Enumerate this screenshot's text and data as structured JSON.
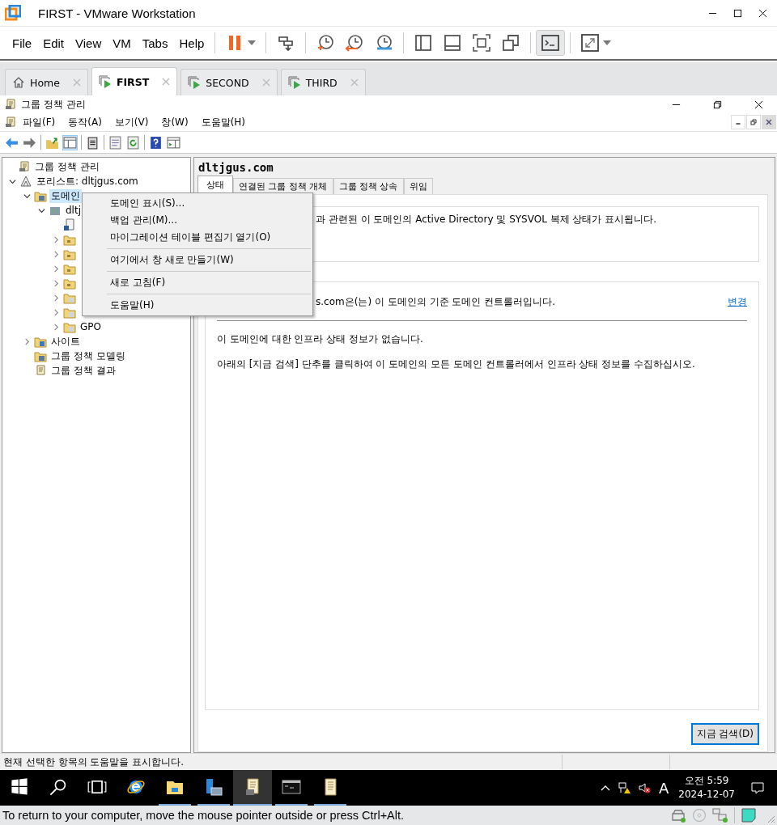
{
  "window": {
    "title": "FIRST - VMware Workstation"
  },
  "menu": [
    "File",
    "Edit",
    "View",
    "VM",
    "Tabs",
    "Help"
  ],
  "toolbar": [
    {
      "kind": "pause",
      "selected": false
    },
    {
      "kind": "send-keys",
      "selected": false
    },
    {
      "kind": "snapshot-take",
      "selected": false
    },
    {
      "kind": "snapshot-revert",
      "selected": false
    },
    {
      "kind": "snapshot-manage",
      "selected": false
    },
    {
      "kind": "library",
      "selected": false
    },
    {
      "kind": "thumbnails",
      "selected": false
    },
    {
      "kind": "fullscreen",
      "selected": false
    },
    {
      "kind": "unity",
      "selected": false
    },
    {
      "kind": "console",
      "selected": true
    },
    {
      "kind": "stretch",
      "selected": false
    }
  ],
  "vm_tabs": [
    {
      "label": "Home",
      "kind": "home",
      "selected": false
    },
    {
      "label": "FIRST",
      "kind": "vm",
      "selected": true
    },
    {
      "label": "SECOND",
      "kind": "vm",
      "selected": false
    },
    {
      "label": "THIRD",
      "kind": "vm",
      "selected": false
    }
  ],
  "guest": {
    "title": "그룹 정책 관리",
    "menu": [
      "파일(F)",
      "동작(A)",
      "보기(V)",
      "창(W)",
      "도움말(H)"
    ],
    "tree": [
      {
        "label": "그룹 정책 관리",
        "kind": "gpm",
        "selected": false,
        "children": [
          {
            "label": "포리스트: dltjgus.com",
            "kind": "forest",
            "expanded": true,
            "selected": false,
            "children": [
              {
                "label": "도메인",
                "kind": "domains",
                "expanded": true,
                "selected": true,
                "children": [
                  {
                    "label": "dltj",
                    "kind": "domain",
                    "expanded": true,
                    "selected": false,
                    "children": [
                      {
                        "kind": "gpo-link",
                        "selected": false
                      },
                      {
                        "kind": "ou",
                        "expanded": false,
                        "selected": false
                      },
                      {
                        "kind": "ou",
                        "expanded": false,
                        "selected": false
                      },
                      {
                        "kind": "ou",
                        "expanded": false,
                        "selected": false
                      },
                      {
                        "kind": "ou",
                        "expanded": false,
                        "selected": false
                      },
                      {
                        "kind": "gpo-folder",
                        "expanded": false,
                        "selected": false
                      },
                      {
                        "kind": "wmi",
                        "expanded": false,
                        "selected": false
                      },
                      {
                        "label": "GPO",
                        "kind": "starter",
                        "expanded": false,
                        "selected": false
                      }
                    ]
                  }
                ]
              },
              {
                "label": "사이트",
                "kind": "sites",
                "expanded": false,
                "selected": false
              },
              {
                "label": "그룹 정책 모델링",
                "kind": "modeling",
                "selected": false
              },
              {
                "label": "그룹 정책 결과",
                "kind": "results",
                "selected": false
              }
            ]
          }
        ]
      }
    ],
    "context_menu": [
      {
        "kind": "item",
        "label": "도메인 표시(S)..."
      },
      {
        "kind": "item",
        "label": "백업 관리(M)..."
      },
      {
        "kind": "item",
        "label": "마이그레이션 테이블 편집기 열기(O)"
      },
      {
        "kind": "separator"
      },
      {
        "kind": "item",
        "label": "여기에서 창 새로 만들기(W)"
      },
      {
        "kind": "separator"
      },
      {
        "kind": "item",
        "label": "새로 고침(F)"
      },
      {
        "kind": "separator"
      },
      {
        "kind": "item",
        "label": "도움말(H)"
      }
    ],
    "detail": {
      "heading": "dltjgus.com",
      "tabs": [
        {
          "label": "상태",
          "selected": true
        },
        {
          "label": "연결된 그룹 정책 개체",
          "selected": false
        },
        {
          "label": "그룹 정책 상속",
          "selected": false
        },
        {
          "label": "위임",
          "selected": false
        }
      ],
      "intro": "과 관련된 이 도메인의 Active Directory 및 SYSVOL 복제 상태가 표시됩니다.",
      "baseline": "s.com은(는) 이 도메인의 기준 도메인 컨트롤러입니다.",
      "change_link": "변경",
      "messages": [
        "이 도메인에 대한 인프라 상태 정보가 없습니다.",
        "아래의 [지금 검색] 단추를 클릭하여 이 도메인의 모든 도메인 컨트롤러에서 인프라 상태 정보를 수집하십시오."
      ],
      "button": "지금 검색(D)"
    },
    "status_bar": "현재 선택한 항목의 도움말을 표시합니다.",
    "taskbar": {
      "apps": [
        {
          "kind": "start",
          "running": false,
          "selected": false
        },
        {
          "kind": "search",
          "running": false,
          "selected": false
        },
        {
          "kind": "task-view",
          "running": false,
          "selected": false
        },
        {
          "kind": "browser",
          "running": false,
          "selected": false
        },
        {
          "kind": "folder",
          "running": true,
          "selected": false
        },
        {
          "kind": "server",
          "running": true,
          "selected": false
        },
        {
          "kind": "gpm",
          "running": true,
          "selected": true
        },
        {
          "kind": "terminal",
          "running": true,
          "selected": false
        },
        {
          "kind": "scroll",
          "running": true,
          "selected": false
        }
      ],
      "ime": "A",
      "time": "오전 5:59",
      "date": "2024-12-07"
    }
  },
  "vm_status": "To return to your computer, move the mouse pointer outside or press Ctrl+Alt."
}
